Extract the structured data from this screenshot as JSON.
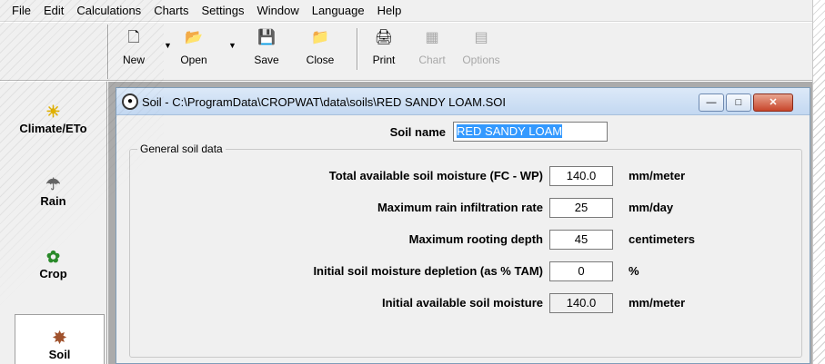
{
  "menu": [
    "File",
    "Edit",
    "Calculations",
    "Charts",
    "Settings",
    "Window",
    "Language",
    "Help"
  ],
  "toolbar": {
    "new": "New",
    "open": "Open",
    "save": "Save",
    "close": "Close",
    "print": "Print",
    "chart": "Chart",
    "options": "Options"
  },
  "sidebar": {
    "items": [
      {
        "label": "Climate/ETo",
        "icon": "sun-icon"
      },
      {
        "label": "Rain",
        "icon": "rain-cloud-icon"
      },
      {
        "label": "Crop",
        "icon": "plant-icon"
      },
      {
        "label": "Soil",
        "icon": "soil-icon"
      }
    ],
    "selected": "Soil"
  },
  "window": {
    "title": "Soil - C:\\ProgramData\\CROPWAT\\data\\soils\\RED SANDY LOAM.SOI",
    "soil_name_label": "Soil name",
    "soil_name_value": "RED SANDY LOAM",
    "group_label": "General soil data",
    "rows": [
      {
        "label": "Total available soil moisture (FC - WP)",
        "value": "140.0",
        "unit": "mm/meter"
      },
      {
        "label": "Maximum rain infiltration rate",
        "value": "25",
        "unit": "mm/day"
      },
      {
        "label": "Maximum rooting depth",
        "value": "45",
        "unit": "centimeters"
      },
      {
        "label": "Initial soil moisture depletion (as % TAM)",
        "value": "0",
        "unit": "%"
      },
      {
        "label": "Initial available soil moisture",
        "value": "140.0",
        "unit": "mm/meter"
      }
    ]
  }
}
